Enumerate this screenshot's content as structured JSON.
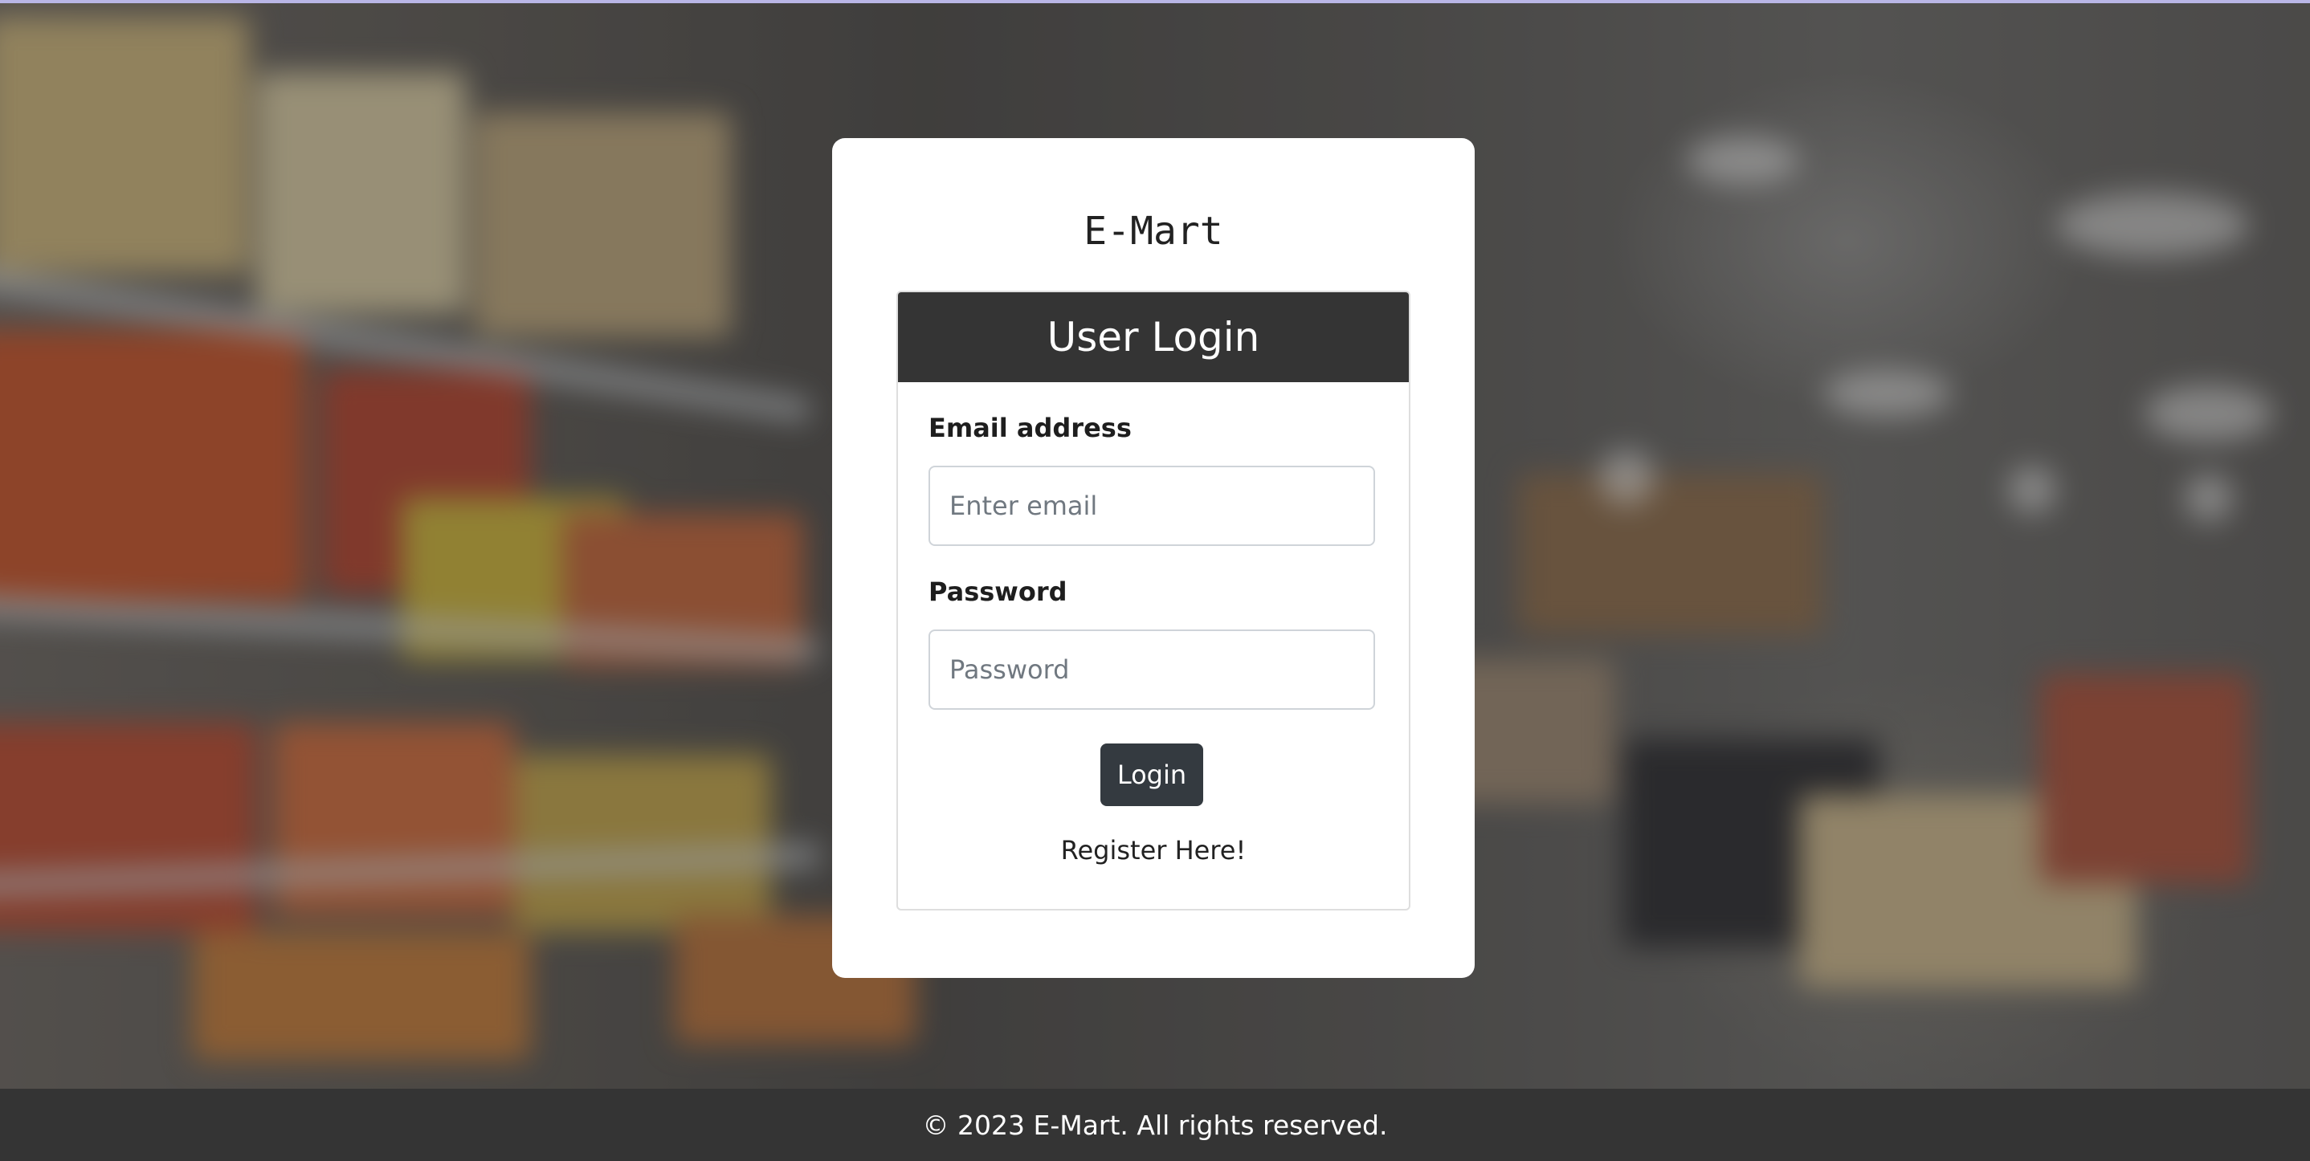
{
  "brand": {
    "name": "E-Mart"
  },
  "login_panel": {
    "title": "User Login",
    "email": {
      "label": "Email address",
      "placeholder": "Enter email",
      "value": ""
    },
    "password": {
      "label": "Password",
      "placeholder": "Password",
      "value": ""
    },
    "login_button": "Login",
    "register_link": "Register Here!"
  },
  "footer": {
    "text": "© 2023 E-Mart. All rights reserved."
  },
  "colors": {
    "header_bg": "#343434",
    "button_bg": "#343a40",
    "footer_bg": "#343434",
    "card_bg": "#ffffff"
  }
}
